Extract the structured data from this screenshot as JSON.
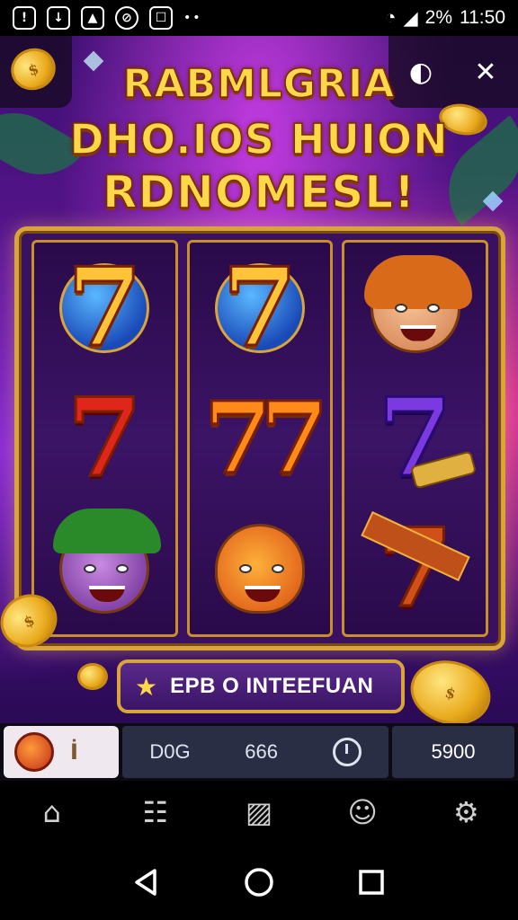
{
  "status_bar": {
    "icons": [
      "notification-icon",
      "download-icon",
      "image-icon",
      "sync-icon",
      "inbox-icon"
    ],
    "dots": "••",
    "battery": "2%",
    "time": "11:50"
  },
  "title": {
    "line1": "RABMLGRIA",
    "line2": "DHO.IOS HUION",
    "line3": "RDNOMESL!"
  },
  "top_controls": {
    "left_icon": "coin-icon",
    "sound_icon": "speaker-icon",
    "close_icon": "close-icon",
    "sound_glyph": "◐",
    "close_glyph": "✕"
  },
  "reels": [
    [
      {
        "type": "seven",
        "style": "gold",
        "label": "7"
      },
      {
        "type": "seven",
        "style": "red",
        "label": "7"
      },
      {
        "type": "face",
        "style": "goblin"
      }
    ],
    [
      {
        "type": "seven",
        "style": "gold",
        "label": "7"
      },
      {
        "type": "seven",
        "style": "orange",
        "label": "77"
      },
      {
        "type": "face",
        "style": "monster"
      }
    ],
    [
      {
        "type": "face",
        "style": "woman"
      },
      {
        "type": "seven",
        "style": "purple",
        "label": "7"
      },
      {
        "type": "ribbon",
        "label": "7"
      }
    ]
  ],
  "spin": {
    "star": "★",
    "label": "EPB O INTEEFUAN"
  },
  "info_bar": {
    "pipe": "İ",
    "label1": "D0G",
    "value1": "666",
    "value2": "5900"
  },
  "nav": [
    "home-icon",
    "document-icon",
    "gallery-icon",
    "profile-icon",
    "settings-icon"
  ],
  "nav_glyphs": [
    "⌂",
    "☷",
    "▨",
    "☺",
    "⚙"
  ],
  "colors": {
    "title_gold": "#ffd84a",
    "frame_gold": "#d9a53a",
    "bg_purple": "#4a1280"
  }
}
